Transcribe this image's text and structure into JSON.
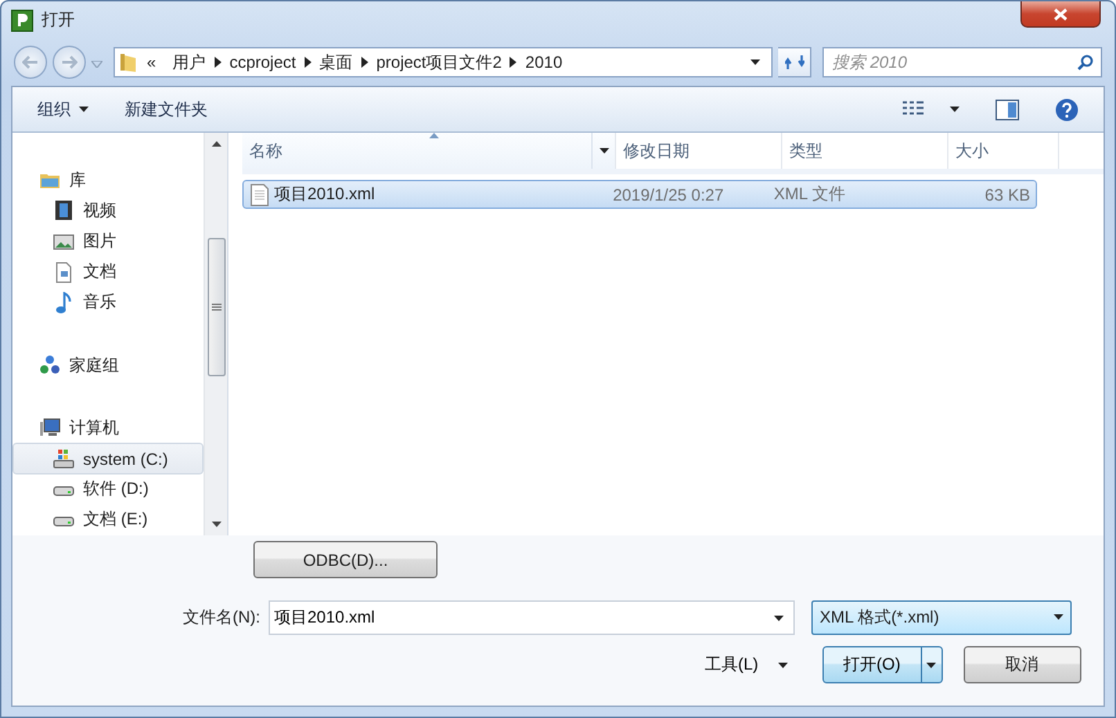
{
  "window": {
    "title": "打开"
  },
  "address": {
    "overflow": "«",
    "segments": [
      "用户",
      "ccproject",
      "桌面",
      "project项目文件2",
      "2010"
    ]
  },
  "search": {
    "placeholder": "搜索 2010"
  },
  "toolbar": {
    "organize": "组织",
    "new_folder": "新建文件夹"
  },
  "nav": [
    {
      "label": "库",
      "kind": "library",
      "selected": false,
      "children": [
        {
          "label": "视频",
          "kind": "video",
          "selected": false
        },
        {
          "label": "图片",
          "kind": "pictures",
          "selected": false
        },
        {
          "label": "文档",
          "kind": "document",
          "selected": false
        },
        {
          "label": "音乐",
          "kind": "music",
          "selected": false
        }
      ]
    },
    {
      "label": "家庭组",
      "kind": "homegroup",
      "selected": false
    },
    {
      "label": "计算机",
      "kind": "computer",
      "selected": false,
      "children": [
        {
          "label": "system (C:)",
          "kind": "system-drive",
          "selected": true
        },
        {
          "label": "软件 (D:)",
          "kind": "drive",
          "selected": false
        },
        {
          "label": "文档 (E:)",
          "kind": "drive",
          "selected": false
        }
      ]
    }
  ],
  "columns": [
    {
      "label": "名称",
      "sorted": true
    },
    {
      "label": "修改日期",
      "sorted": false
    },
    {
      "label": "类型",
      "sorted": false
    },
    {
      "label": "大小",
      "sorted": false
    }
  ],
  "files": [
    {
      "name": "项目2010.xml",
      "modified": "2019/1/25 0:27",
      "type": "XML 文件",
      "size": "63 KB",
      "selected": true
    }
  ],
  "odbc_button": "ODBC(D)...",
  "filename": {
    "label": "文件名(N):",
    "value": "项目2010.xml"
  },
  "filter": {
    "value": "XML 格式(*.xml)"
  },
  "tools": "工具(L)",
  "open_button": "打开(O)",
  "cancel_button": "取消"
}
